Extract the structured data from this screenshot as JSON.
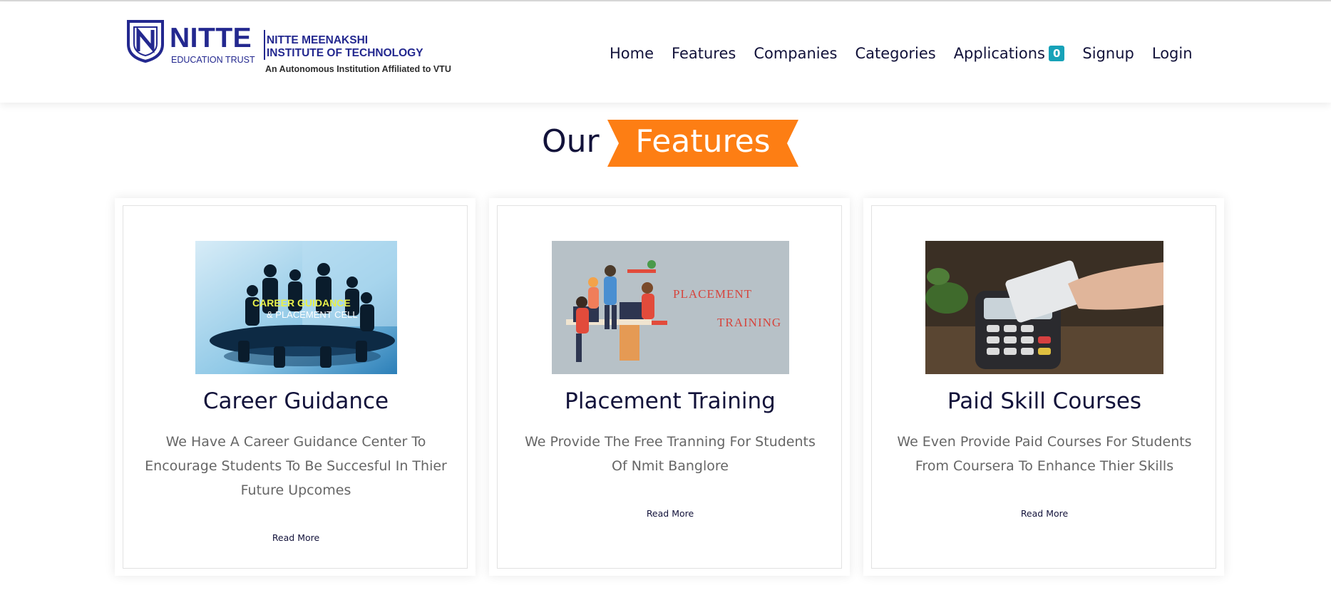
{
  "header": {
    "logo": {
      "brand": "NITTE",
      "trust": "EDUCATION TRUST",
      "institute_line1": "NITTE MEENAKSHI",
      "institute_line2": "INSTITUTE OF TECHNOLOGY",
      "tagline": "An Autonomous Institution Affiliated to VTU"
    },
    "nav": [
      {
        "label": "Home"
      },
      {
        "label": "Features"
      },
      {
        "label": "Companies"
      },
      {
        "label": "Categories"
      },
      {
        "label": "Applications",
        "badge": "0"
      },
      {
        "label": "Signup"
      },
      {
        "label": "Login"
      }
    ]
  },
  "section": {
    "heading_prefix": "Our",
    "heading_highlight": "Features"
  },
  "cards": [
    {
      "title": "Career Guidance",
      "description": "We Have A Career Guidance Center To Encourage Students To Be Succesful In Thier Future Upcomes",
      "image_text_1": "CAREER GUIDANCE",
      "image_text_2": "& PLACEMENT CELL",
      "link": "Read More"
    },
    {
      "title": "Placement Training",
      "description": "We Provide The Free Tranning For Students Of Nmit Banglore",
      "image_text_1": "PLACEMENT",
      "image_text_2": "TRAINING",
      "link": "Read More"
    },
    {
      "title": "Paid Skill Courses",
      "description": "We Even Provide Paid Courses For Students From Coursera To Enhance Thier Skills",
      "link": "Read More"
    }
  ],
  "colors": {
    "navy": "#12123a",
    "brand_blue": "#23288f",
    "ribbon_orange": "#fd7e14",
    "badge_teal": "#17a2b8",
    "body_text": "#666666"
  }
}
